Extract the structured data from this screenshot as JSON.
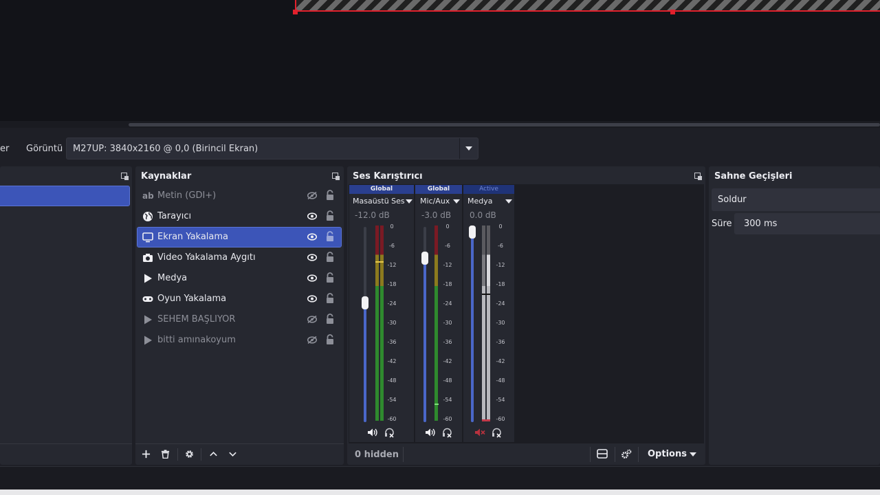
{
  "properties_bar": {
    "truncated_label": "er",
    "display_label": "Görüntü",
    "display_value": "M27UP: 3840x2160 @ 0,0 (Birincil Ekran)"
  },
  "sources": {
    "title": "Kaynaklar",
    "items": [
      {
        "label": "Metin (GDI+)",
        "icon": "text-icon",
        "visible": false
      },
      {
        "label": "Tarayıcı",
        "icon": "globe-icon",
        "visible": true
      },
      {
        "label": "Ekran Yakalama",
        "icon": "monitor-icon",
        "visible": true,
        "selected": true
      },
      {
        "label": "Video Yakalama Aygıtı",
        "icon": "camera-icon",
        "visible": true
      },
      {
        "label": "Medya",
        "icon": "play-icon",
        "visible": true
      },
      {
        "label": "Oyun Yakalama",
        "icon": "gamepad-icon",
        "visible": true
      },
      {
        "label": "SEHEM BAŞLIYOR",
        "icon": "play-icon",
        "visible": false
      },
      {
        "label": "bitti amınakoyum",
        "icon": "play-icon",
        "visible": false
      }
    ]
  },
  "mixer": {
    "title": "Ses Karıştırıcı",
    "channels": [
      {
        "badge": "Global",
        "name": "Masaüstü Ses",
        "db": "-12.0 dB",
        "fader_level": 0.62,
        "muted": false
      },
      {
        "badge": "Global",
        "name": "Mic/Aux",
        "db": "-3.0 dB",
        "fader_level": 0.85,
        "muted": false
      },
      {
        "badge": "Active",
        "name": "Medya",
        "db": "0.0 dB",
        "fader_level": 1.0,
        "muted": true
      }
    ],
    "ticks": [
      "0",
      "-6",
      "-12",
      "-18",
      "-24",
      "-30",
      "-36",
      "-42",
      "-48",
      "-54",
      "-60"
    ],
    "hidden_label": "0 hidden",
    "options_label": "Options"
  },
  "transitions": {
    "title": "Sahne Geçişleri",
    "transition_value": "Soldur",
    "duration_label": "Süre",
    "duration_value": "300 ms"
  },
  "colors": {
    "accent": "#3c55b8",
    "preview_border": "#e2202c",
    "meter_green": "#2f8a2e",
    "meter_yellow": "#8c7a1e",
    "meter_red": "#7a1a24",
    "badge_global": "#2a3f8f",
    "badge_active": "#1f3377"
  }
}
